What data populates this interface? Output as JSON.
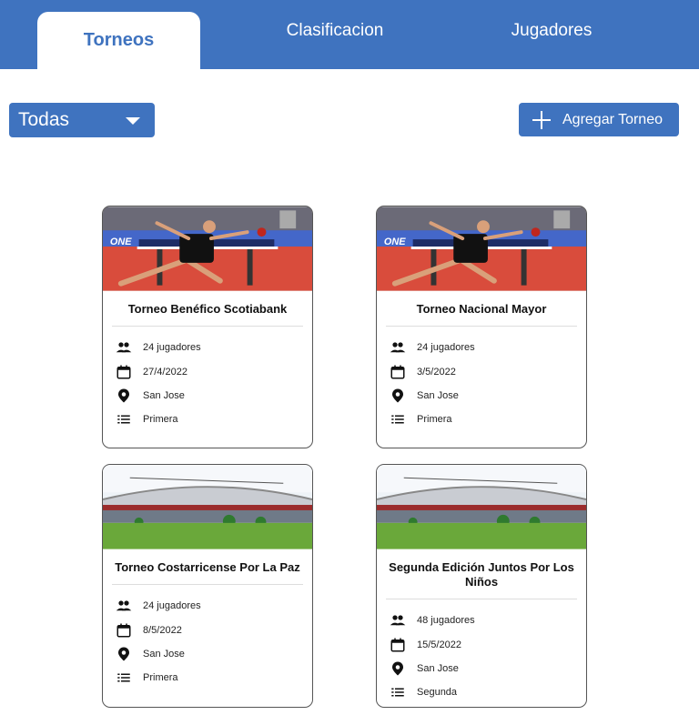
{
  "tabs": [
    "Torneos",
    "Clasificacion",
    "Jugadores"
  ],
  "filter": {
    "selected": "Todas"
  },
  "add_button": {
    "label": "Agregar Torneo"
  },
  "tournaments": [
    {
      "title": "Torneo Benéfico Scotiabank",
      "players": "24 jugadores",
      "date": "27/4/2022",
      "location": "San Jose",
      "category": "Primera",
      "image": "table-tennis-photo"
    },
    {
      "title": "Torneo Nacional Mayor",
      "players": "24 jugadores",
      "date": "3/5/2022",
      "location": "San Jose",
      "category": "Primera",
      "image": "table-tennis-photo"
    },
    {
      "title": "Torneo Costarricense Por La Paz",
      "players": "24 jugadores",
      "date": "8/5/2022",
      "location": "San Jose",
      "category": "Primera",
      "image": "stadium-photo"
    },
    {
      "title": "Segunda Edición Juntos Por Los Niños",
      "players": "48 jugadores",
      "date": "15/5/2022",
      "location": "San Jose",
      "category": "Segunda",
      "image": "stadium-photo"
    }
  ],
  "colors": {
    "brand": "#3f73bf",
    "white": "#ffffff"
  }
}
